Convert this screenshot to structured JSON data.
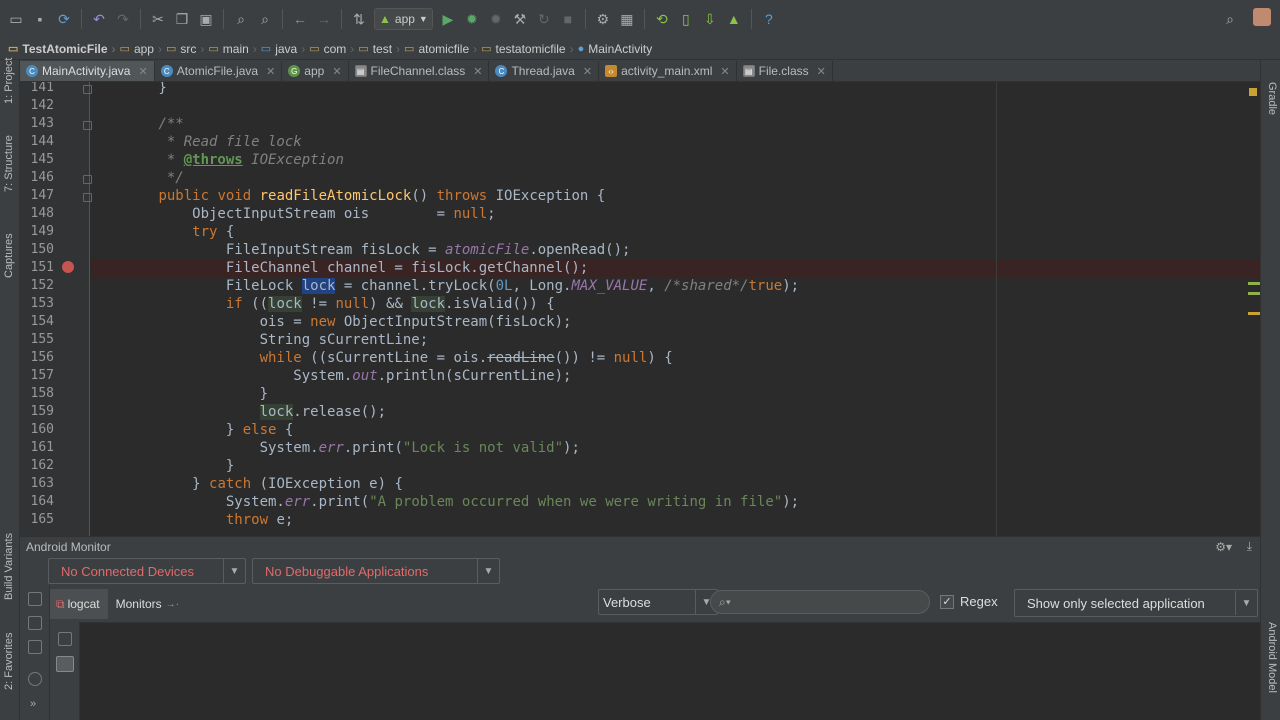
{
  "run_config": "app",
  "breadcrumbs": [
    "TestAtomicFile",
    "app",
    "src",
    "main",
    "java",
    "com",
    "test",
    "atomicfile",
    "testatomicfile",
    "MainActivity"
  ],
  "tabs": [
    {
      "label": "MainActivity.java",
      "icon": "class-icon",
      "active": true
    },
    {
      "label": "AtomicFile.java",
      "icon": "class-icon",
      "active": false
    },
    {
      "label": "app",
      "icon": "gradle-icon",
      "active": false
    },
    {
      "label": "FileChannel.class",
      "icon": "class-file-icon",
      "active": false
    },
    {
      "label": "Thread.java",
      "icon": "class-icon",
      "active": false
    },
    {
      "label": "activity_main.xml",
      "icon": "xml-icon",
      "active": false
    },
    {
      "label": "File.class",
      "icon": "class-file-icon",
      "active": false
    }
  ],
  "left_tool_windows": [
    "1: Project",
    "7: Structure",
    "Captures",
    "Build Variants",
    "2: Favorites"
  ],
  "right_tool_windows": [
    "Gradle",
    "Android Model"
  ],
  "editor": {
    "line_numbers": [
      "141",
      "142",
      "143",
      "144",
      "145",
      "146",
      "147",
      "148",
      "149",
      "150",
      "151",
      "152",
      "153",
      "154",
      "155",
      "156",
      "157",
      "158",
      "159",
      "160",
      "161",
      "162",
      "163",
      "164",
      "165"
    ],
    "breakpoint_line": "151"
  },
  "monitor": {
    "title": "Android Monitor",
    "device_combo": "No Connected Devices",
    "app_combo": "No Debuggable Applications",
    "tab_logcat": "logcat",
    "tab_monitors": "Monitors",
    "log_level": "Verbose",
    "search_placeholder": "",
    "regex_label": "Regex",
    "filter": "Show only selected application"
  },
  "colors": {
    "keyword": "#cc7832",
    "comment": "#808080",
    "method": "#ffc66d",
    "string": "#6a8759",
    "number": "#6897bb",
    "static": "#9876aa",
    "error": "#e26a6a"
  }
}
